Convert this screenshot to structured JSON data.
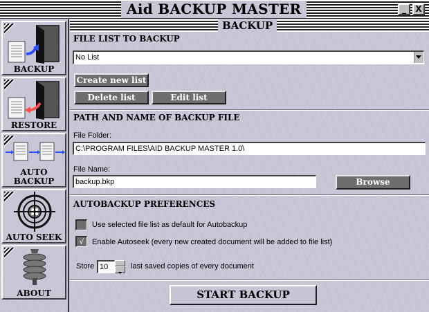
{
  "window": {
    "title": "Aid BACKUP MASTER",
    "minimize_glyph": "_",
    "close_glyph": "X"
  },
  "sidebar": {
    "items": [
      {
        "label": "BACKUP",
        "icon": "backup-icon"
      },
      {
        "label": "RESTORE",
        "icon": "restore-icon"
      },
      {
        "label_line1": "AUTO",
        "label_line2": "BACKUP",
        "icon": "auto-backup-icon"
      },
      {
        "label": "AUTO SEEK",
        "icon": "auto-seek-icon"
      },
      {
        "label": "ABOUT",
        "icon": "about-icon"
      }
    ]
  },
  "main": {
    "header": "BACKUP",
    "file_list_section": {
      "title": "FILE LIST TO BACKUP",
      "selected": "No List",
      "create_label": "Create new list",
      "delete_label": "Delete list",
      "edit_label": "Edit list"
    },
    "path_section": {
      "title": "PATH AND NAME OF BACKUP FILE",
      "folder_label": "File Folder:",
      "folder_value": "C:\\PROGRAM FILES\\AID BACKUP MASTER 1.0\\",
      "name_label": "File Name:",
      "name_value": "backup.bkp",
      "browse_label": "Browse"
    },
    "prefs_section": {
      "title": "AUTOBACKUP PREFERENCES",
      "default_list_label": "Use selected file list as default for Autobackup",
      "default_list_checked": false,
      "autoseek_label": "Enable Autoseek (every new created document will be added to file list)",
      "autoseek_checked": true,
      "check_glyph": "√",
      "store_label": "Store",
      "store_value": "10",
      "store_suffix": "last saved copies of every document"
    },
    "start_label": "START BACKUP"
  },
  "colors": {
    "panel": "#c6c6d6",
    "button_dark": "#6e6e6e"
  }
}
